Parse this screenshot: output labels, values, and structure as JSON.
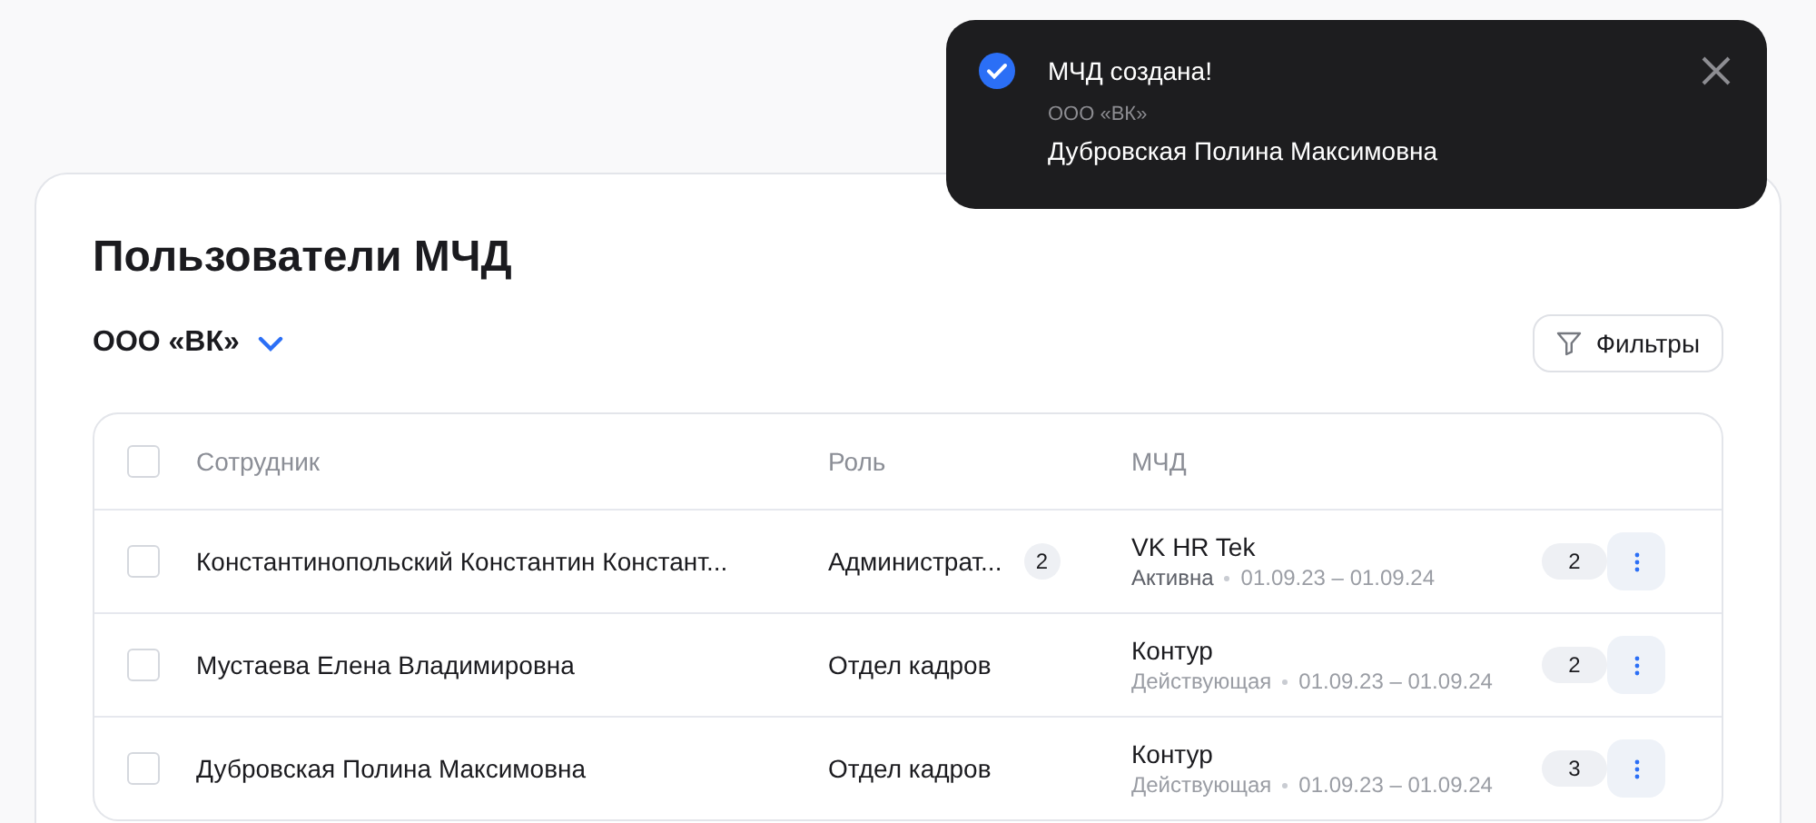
{
  "toast": {
    "title": "МЧД создана!",
    "organization": "ООО «ВК»",
    "person": "Дубровская Полина Максимовна"
  },
  "page": {
    "title": "Пользователи МЧД",
    "organization": "ООО «ВК»",
    "filter_button": "Фильтры"
  },
  "table": {
    "select_all_checked": false,
    "columns": [
      "Сотрудник",
      "Роль",
      "МЧД"
    ],
    "rows": [
      {
        "checked": false,
        "employee": "Константинопольский Константин Констант...",
        "role": "Администрат...",
        "role_count": "2",
        "mchd": "VK HR Tek",
        "status": "Активна",
        "kind": "active",
        "period": "01.09.23 – 01.09.24",
        "mchd_count": "2"
      },
      {
        "checked": false,
        "employee": "Мустаева Елена Владимировна",
        "role": "Отдел кадров",
        "mchd": "Контур",
        "status": "Действующая",
        "kind": "valid",
        "period": "01.09.23 – 01.09.24",
        "mchd_count": "2"
      },
      {
        "checked": false,
        "employee": "Дубровская Полина Максимовна",
        "role": "Отдел кадров",
        "mchd": "Контур",
        "status": "Действующая",
        "kind": "valid",
        "period": "01.09.23 – 01.09.24",
        "mchd_count": "3"
      }
    ]
  }
}
